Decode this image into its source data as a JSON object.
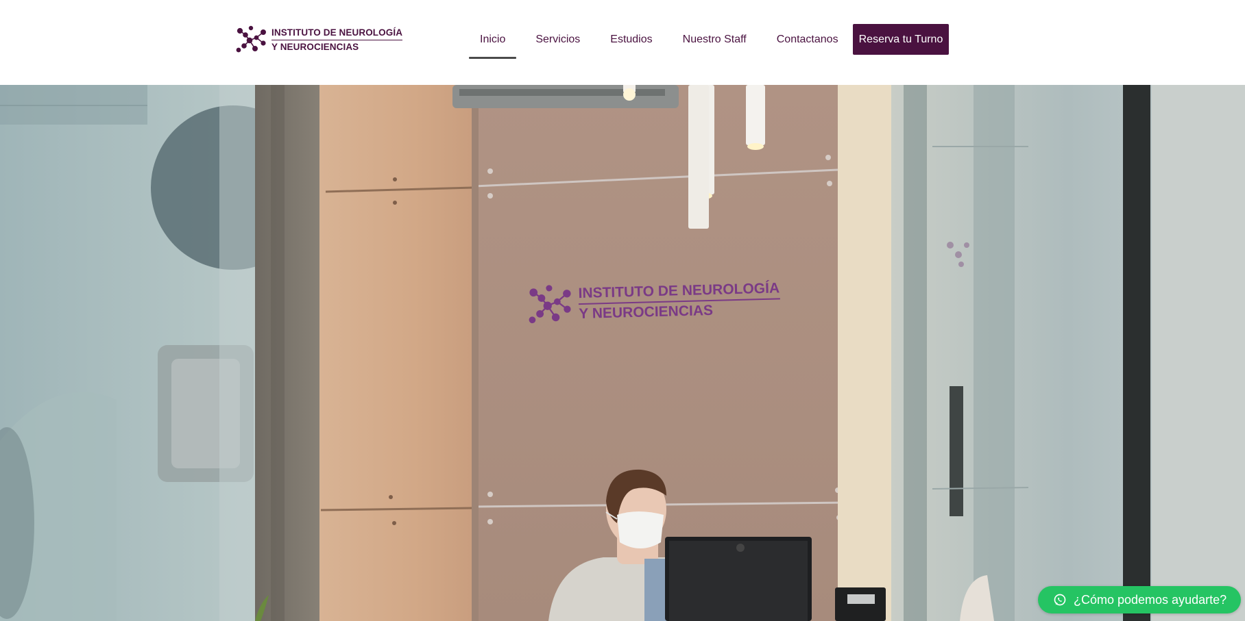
{
  "brand": {
    "line1": "INSTITUTO DE NEUROLOGÍA",
    "line2": "Y NEUROCIENCIAS",
    "logo_icon": "neuron-network-icon",
    "color": "#4a1240"
  },
  "nav": {
    "items": [
      {
        "label": "Inicio",
        "active": true
      },
      {
        "label": "Servicios",
        "active": false
      },
      {
        "label": "Estudios",
        "active": false
      },
      {
        "label": "Nuestro Staff",
        "active": false
      },
      {
        "label": "Contactanos",
        "active": false
      }
    ],
    "cta_label": "Reserva tu Turno",
    "cta_color": "#4a1240"
  },
  "hero": {
    "wall_sign_line1": "INSTITUTO DE NEUROLOGÍA",
    "wall_sign_line2": "Y NEUROCIENCIAS",
    "wall_sign_color": "#7a3a86"
  },
  "whatsapp": {
    "label": "¿Cómo podemos ayudarte?",
    "icon": "whatsapp-icon",
    "color": "#25c463"
  }
}
